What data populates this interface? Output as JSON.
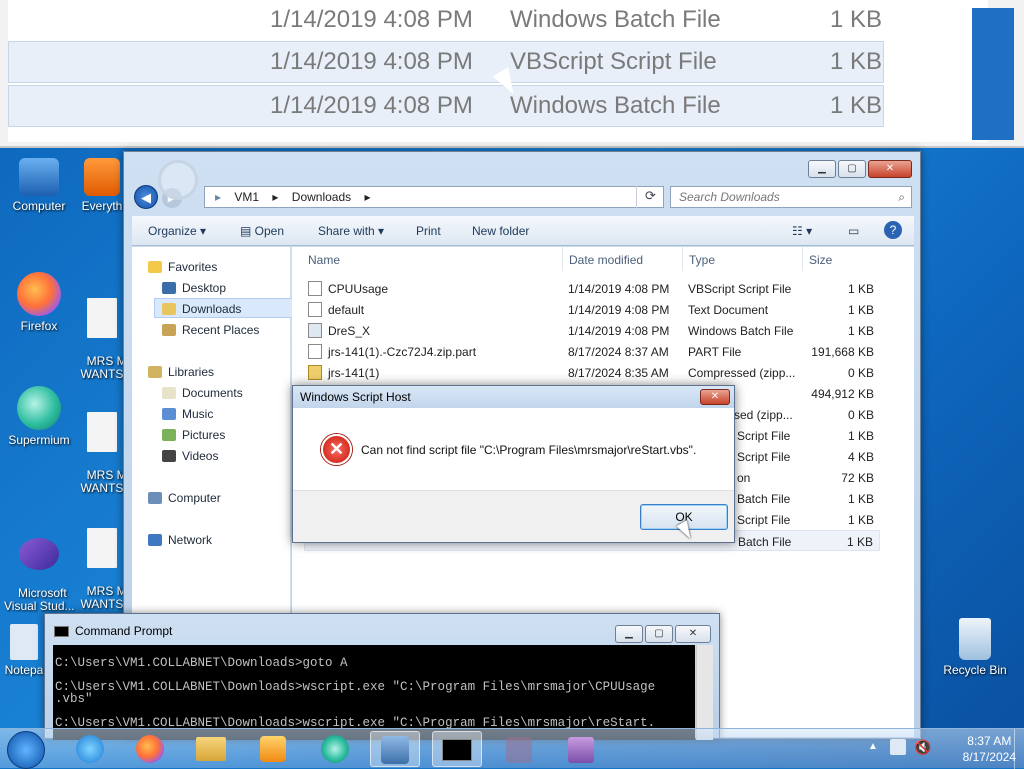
{
  "zoom": {
    "rows": [
      {
        "date": "1/14/2019 4:08 PM",
        "type": "Windows Batch File",
        "size": "1 KB"
      },
      {
        "date": "1/14/2019 4:08 PM",
        "type": "VBScript Script File",
        "size": "1 KB"
      },
      {
        "date": "1/14/2019 4:08 PM",
        "type": "Windows Batch File",
        "size": "1 KB"
      }
    ]
  },
  "desktop_icons": [
    {
      "label": "Computer",
      "icon": "computer-icon"
    },
    {
      "label": "Everyth",
      "icon": "everything-icon"
    },
    {
      "label": "Firefox",
      "icon": "firefox-icon"
    },
    {
      "label": "MRS M\nWANTS",
      "icon": "text-file-icon"
    },
    {
      "label": "Supermium",
      "icon": "supermium-icon"
    },
    {
      "label": "MRS M\nWANTS",
      "icon": "text-file-icon"
    },
    {
      "label": "Microsoft\nVisual Stud...",
      "icon": "visual-studio-icon"
    },
    {
      "label": "MRS M\nWANTS",
      "icon": "text-file-icon"
    },
    {
      "label": "Notepa",
      "icon": "notepad-icon"
    },
    {
      "label": "Recycle Bin",
      "icon": "recycle-bin-icon"
    }
  ],
  "explorer": {
    "breadcrumb": [
      "VM1",
      "Downloads"
    ],
    "search_placeholder": "Search Downloads",
    "toolbar": {
      "organize": "Organize",
      "open": "Open",
      "share_with": "Share with",
      "print": "Print",
      "new_folder": "New folder"
    },
    "nav": {
      "favorites": "Favorites",
      "desktop": "Desktop",
      "downloads": "Downloads",
      "recent": "Recent Places",
      "libraries": "Libraries",
      "documents": "Documents",
      "music": "Music",
      "pictures": "Pictures",
      "videos": "Videos",
      "computer": "Computer",
      "network": "Network"
    },
    "columns": {
      "name": "Name",
      "date": "Date modified",
      "type": "Type",
      "size": "Size"
    },
    "files": [
      {
        "name": "CPUUsage",
        "date": "1/14/2019 4:08 PM",
        "type": "VBScript Script File",
        "size": "1 KB"
      },
      {
        "name": "default",
        "date": "1/14/2019 4:08 PM",
        "type": "Text Document",
        "size": "1 KB"
      },
      {
        "name": "DreS_X",
        "date": "1/14/2019 4:08 PM",
        "type": "Windows Batch File",
        "size": "1 KB"
      },
      {
        "name": "jrs-141(1).-Czc72J4.zip.part",
        "date": "8/17/2024 8:37 AM",
        "type": "PART File",
        "size": "191,668 KB"
      },
      {
        "name": "jrs-141(1)",
        "date": "8/17/2024 8:35 AM",
        "type": "Compressed (zipp...",
        "size": "0 KB"
      }
    ],
    "partial_rows": [
      {
        "type": "",
        "size": "494,912 KB"
      },
      {
        "type": "sed (zipp...",
        "size": "0 KB"
      },
      {
        "type": "Script File",
        "size": "1 KB"
      },
      {
        "type": "Script File",
        "size": "4 KB"
      },
      {
        "type": "on",
        "size": "72 KB"
      },
      {
        "type": "Batch File",
        "size": "1 KB"
      },
      {
        "type": "Script File",
        "size": "1 KB"
      },
      {
        "type": "Batch File",
        "size": "1 KB"
      }
    ]
  },
  "dialog": {
    "title": "Windows Script Host",
    "message": "Can not find script file \"C:\\Program Files\\mrsmajor\\reStart.vbs\".",
    "ok": "OK",
    "close": "✕"
  },
  "cmd": {
    "title": "Command Prompt",
    "lines": [
      "C:\\Users\\VM1.COLLABNET\\Downloads>goto A",
      "",
      "C:\\Users\\VM1.COLLABNET\\Downloads>wscript.exe \"C:\\Program Files\\mrsmajor\\CPUUsage",
      ".vbs\"",
      "",
      "C:\\Users\\VM1.COLLABNET\\Downloads>wscript.exe \"C:\\Program Files\\mrsmajor\\reStart."
    ]
  },
  "taskbar": {
    "time": "8:37 AM",
    "date": "8/17/2024"
  },
  "colors": {
    "accent": "#1476c6",
    "dialog_close": "#c8432b"
  }
}
